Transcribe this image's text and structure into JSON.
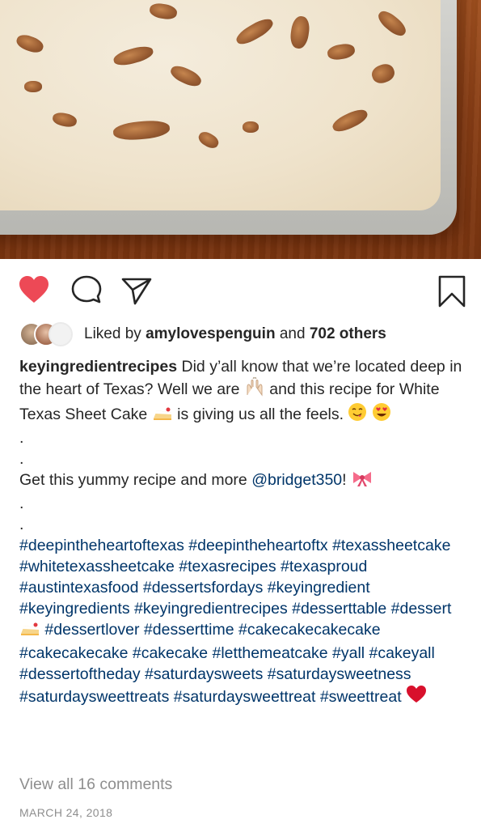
{
  "post": {
    "image_alt": "White Texas Sheet Cake with pecans",
    "actions": {
      "like_icon": "heart-filled-icon",
      "comment_icon": "comment-icon",
      "share_icon": "direct-share-icon",
      "save_icon": "bookmark-icon",
      "like_color": "#ed4956"
    },
    "likes": {
      "prefix": "Liked by",
      "user": "amylovespenguin",
      "conjunction": "and",
      "others": "702 others"
    },
    "caption": {
      "username": "keyingredientrecipes",
      "line1": "Did y’all know that we’re located deep in the heart of Texas? Well we are",
      "line2": "and this recipe for White Texas Sheet Cake",
      "line3": "is giving us all the feels.",
      "dot": ".",
      "promo_text": "Get this yummy recipe and more",
      "mention": "@bridget350",
      "promo_end": "!",
      "hashtags": [
        "#deepintheheartoftexas",
        "#deepintheheartoftx",
        "#texassheetcake",
        "#whitetexassheetcake",
        "#texasrecipes",
        "#texasproud",
        "#austintexasfood",
        "#dessertsfordays",
        "#keyingredient",
        "#keyingredients",
        "#keyingredientrecipes",
        "#desserttable",
        "#dessert",
        "#dessertlover",
        "#desserttime",
        "#cakecakecakecake",
        "#cakecakecake",
        "#cakecake",
        "#letthemeatcake",
        "#yall",
        "#cakeyall",
        "#dessertoftheday",
        "#saturdaysweets",
        "#saturdaysweetness",
        "#saturdaysweettreats",
        "#saturdaysweettreat",
        "#sweettreat"
      ]
    },
    "view_comments": "View all 16 comments",
    "date": "MARCH 24, 2018",
    "colors": {
      "link": "#003569",
      "muted": "#8e8e8e",
      "text": "#262626"
    }
  }
}
